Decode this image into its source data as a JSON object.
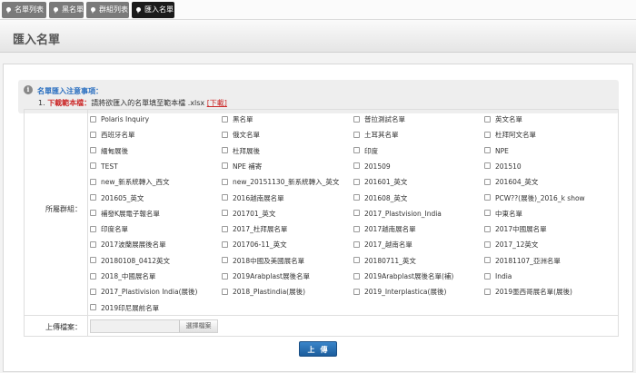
{
  "tabs": [
    {
      "label": "名單列表",
      "active": false
    },
    {
      "label": "黑名單",
      "active": false
    },
    {
      "label": "群組列表",
      "active": false
    },
    {
      "label": "匯入名單",
      "active": true
    }
  ],
  "header": {
    "title": "匯入名單"
  },
  "notice": {
    "icon": "info-icon",
    "title": "名單匯入注意事項：",
    "item_number": "1.",
    "item_label": "下載範本檔：",
    "item_text": "請將欲匯入的名單填至範本檔 .xlsx ",
    "item_link": "[下載]"
  },
  "form": {
    "group_label": "所屬群組：",
    "upload_label": "上傳檔案：",
    "file_button": "選擇檔案",
    "file_value": "",
    "submit_label": "上傳"
  },
  "groups": [
    [
      "Polaris Inquiry",
      "黑名單",
      "普拉測試名單",
      "英文名單"
    ],
    [
      "西班牙名單",
      "俄文名單",
      "土耳其名單",
      "杜拜阿文名單"
    ],
    [
      "緬甸展後",
      "杜拜展後",
      "印度",
      "NPE"
    ],
    [
      "TEST",
      "NPE 補寄",
      "201509",
      "201510"
    ],
    [
      "new_新系統轉入_西文",
      "new_20151130_新系統轉入_英文",
      "201601_英文",
      "201604_英文"
    ],
    [
      "201605_英文",
      "2016越南展名單",
      "201608_英文",
      "PCW??(展後)_2016_k show"
    ],
    [
      "補發K展電子報名單",
      "201701_英文",
      "2017_Plastvision_India",
      "中東名單"
    ],
    [
      "印度名單",
      "2017_杜拜展名單",
      "2017越南展名單",
      "2017中國展名單"
    ],
    [
      "2017波蘭展展後名單",
      "201706-11_英文",
      "2017_越南名單",
      "2017_12英文"
    ],
    [
      "20180108_0412英文",
      "2018中國及美國展名單",
      "20180711_英文",
      "20181107_亞洲名單"
    ],
    [
      "2018_中國展名單",
      "2019Arabplast展後名單",
      "2019Arabplast展後名單(補)",
      "India"
    ],
    [
      "2017_Plastivision India(展後)",
      "2018_Plastindia(展後)",
      "2019_Interplastica(展後)",
      "2019墨西哥展名單(展後)"
    ],
    [
      "2019印尼展前名單"
    ]
  ]
}
